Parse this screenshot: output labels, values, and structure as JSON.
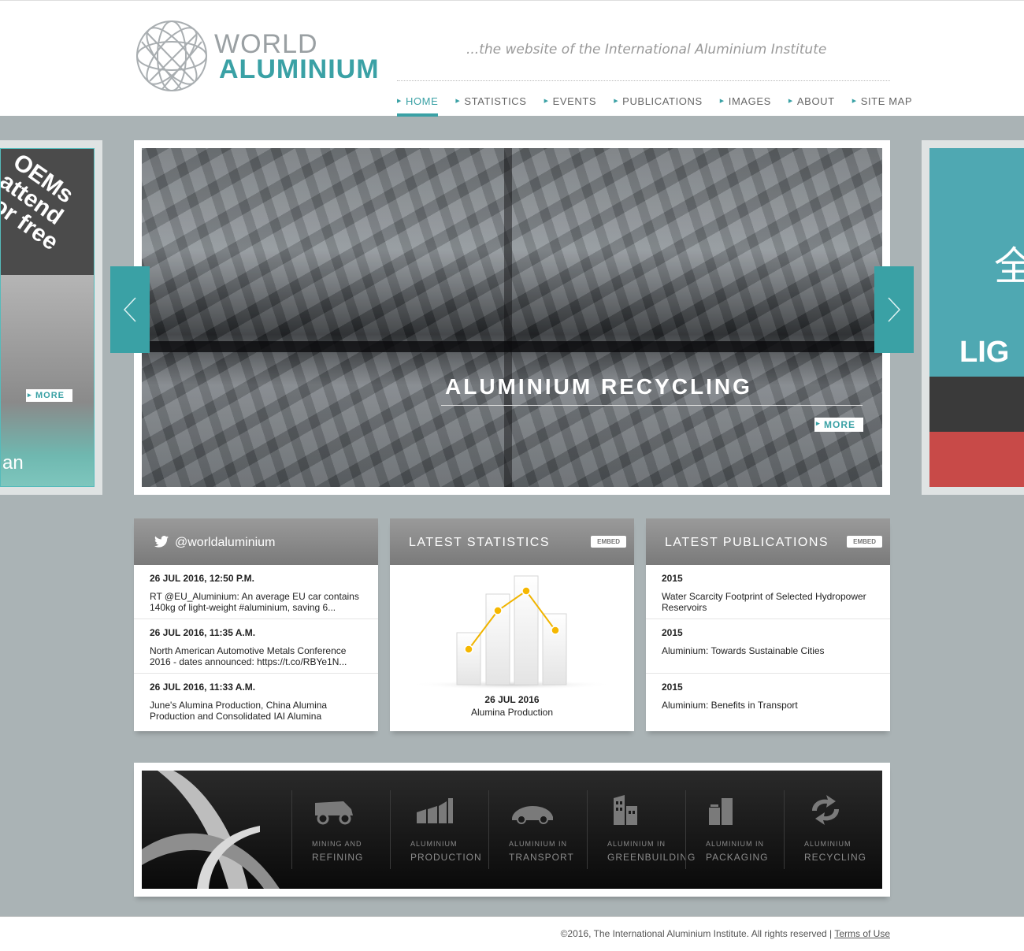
{
  "logo": {
    "line1": "WORLD",
    "line2": "ALUMINIUM"
  },
  "tagline": "...the website of the International Aluminium Institute",
  "nav": [
    {
      "label": "HOME",
      "active": true
    },
    {
      "label": "STATISTICS"
    },
    {
      "label": "EVENTS"
    },
    {
      "label": "PUBLICATIONS"
    },
    {
      "label": "IMAGES"
    },
    {
      "label": "ABOUT"
    },
    {
      "label": "SITE MAP"
    }
  ],
  "slider": {
    "left_panel": {
      "text": "OEMs attend for free",
      "more": "MORE",
      "caption_fragment": "an"
    },
    "main": {
      "title": "ALUMINIUM RECYCLING",
      "more": "MORE"
    },
    "right_panel": {
      "char": "全",
      "text": "LIG"
    },
    "prev_icon": "chevron-left-icon",
    "next_icon": "chevron-right-icon"
  },
  "twitter": {
    "handle": "@worldaluminium",
    "tweets": [
      {
        "date": "26 JUL 2016, 12:50 P.M.",
        "text": "RT @EU_Aluminium: An average EU car contains 140kg of light-weight #aluminium, saving 6..."
      },
      {
        "date": "26 JUL 2016, 11:35 A.M.",
        "text": "North American Automotive Metals Conference 2016 - dates announced: https://t.co/RBYe1N..."
      },
      {
        "date": "26 JUL 2016, 11:33 A.M.",
        "text": "June's Alumina Production, China Alumina Production and Consolidated IAI Alumina Producti..."
      }
    ]
  },
  "stats": {
    "title": "LATEST STATISTICS",
    "embed": "EMBED",
    "date": "26 JUL 2016",
    "name": "Alumina Production"
  },
  "publications": {
    "title": "LATEST PUBLICATIONS",
    "embed": "EMBED",
    "items": [
      {
        "year": "2015",
        "title": "Water Scarcity Footprint of Selected Hydropower Reservoirs"
      },
      {
        "year": "2015",
        "title": "Aluminium: Towards Sustainable Cities"
      },
      {
        "year": "2015",
        "title": "Aluminium: Benefits in Transport"
      }
    ]
  },
  "sectors": [
    {
      "line1": "MINING AND",
      "line2": "REFINING",
      "icon": "mining-truck-icon"
    },
    {
      "line1": "ALUMINIUM",
      "line2": "PRODUCTION",
      "icon": "factory-icon"
    },
    {
      "line1": "ALUMINIUM IN",
      "line2": "TRANSPORT",
      "icon": "car-icon"
    },
    {
      "line1": "ALUMINIUM IN",
      "line2": "GREENBUILDING",
      "icon": "building-icon"
    },
    {
      "line1": "ALUMINIUM IN",
      "line2": "PACKAGING",
      "icon": "packaging-icon"
    },
    {
      "line1": "ALUMINIUM",
      "line2": "RECYCLING",
      "icon": "recycling-icon"
    }
  ],
  "footer": {
    "copyright": "©2016, The International Aluminium Institute. All rights reserved |",
    "terms": "Terms of Use"
  },
  "colors": {
    "accent": "#3aa1a5",
    "background": "#aab3b5",
    "header_gray": "#8a8a8a"
  }
}
